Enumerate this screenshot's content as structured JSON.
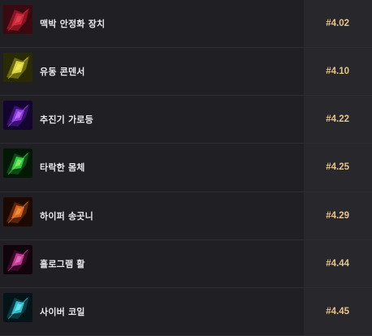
{
  "items": [
    {
      "name": "맥박 안정화 장치",
      "rank": "#4.02",
      "icon": "pulse-stabilizer-icon",
      "colors": [
        "#8a1420",
        "#c8283c",
        "#3a0a10",
        "#e04050"
      ]
    },
    {
      "name": "유동 콘덴서",
      "rank": "#4.10",
      "icon": "fluid-condenser-icon",
      "colors": [
        "#6b6a10",
        "#d6d23a",
        "#2a2a05",
        "#f0e860"
      ]
    },
    {
      "name": "추진기 가로등",
      "rank": "#4.22",
      "icon": "thruster-lamp-icon",
      "colors": [
        "#3a1070",
        "#8a3ad8",
        "#140530",
        "#c070ff"
      ]
    },
    {
      "name": "타락한 몸체",
      "rank": "#4.25",
      "icon": "corrupted-body-icon",
      "colors": [
        "#0e4a14",
        "#34c83c",
        "#041806",
        "#7cf070"
      ]
    },
    {
      "name": "하이퍼 송곳니",
      "rank": "#4.29",
      "icon": "hyper-fang-icon",
      "colors": [
        "#5a2408",
        "#d8641c",
        "#1c0a02",
        "#f09040"
      ]
    },
    {
      "name": "홀로그램 활",
      "rank": "#4.44",
      "icon": "hologram-bow-icon",
      "colors": [
        "#3a0a28",
        "#c03890",
        "#12040c",
        "#e070c0"
      ]
    },
    {
      "name": "사이버 코일",
      "rank": "#4.45",
      "icon": "cyber-coil-icon",
      "colors": [
        "#0a3a44",
        "#30b8c8",
        "#041418",
        "#70e8f0"
      ]
    }
  ]
}
